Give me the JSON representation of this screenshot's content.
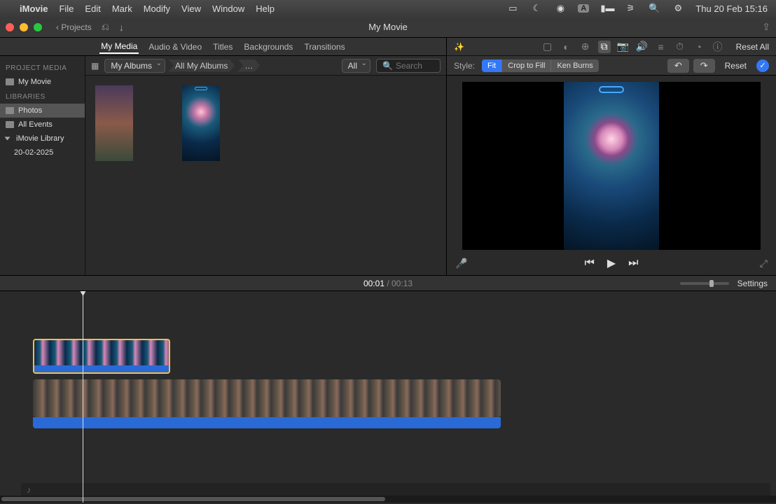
{
  "menubar": {
    "app": "iMovie",
    "items": [
      "File",
      "Edit",
      "Mark",
      "Modify",
      "View",
      "Window",
      "Help"
    ],
    "datetime": "Thu 20 Feb  15:16",
    "a_badge": "A"
  },
  "titlebar": {
    "back_label": "Projects",
    "title": "My Movie"
  },
  "tabs": {
    "my_media": "My Media",
    "audio_video": "Audio & Video",
    "titles": "Titles",
    "backgrounds": "Backgrounds",
    "transitions": "Transitions"
  },
  "sidebar": {
    "project_media_h": "PROJECT MEDIA",
    "project_item": "My Movie",
    "libraries_h": "LIBRARIES",
    "photos": "Photos",
    "all_events": "All Events",
    "imovie_library": "iMovie Library",
    "date_item": "20-02-2025"
  },
  "browser": {
    "dropdown": "My Albums",
    "crumb1": "All My Albums",
    "crumb2": "…",
    "filter": "All",
    "search_placeholder": "Search"
  },
  "adjust": {
    "reset_all": "Reset All"
  },
  "crop": {
    "style_label": "Style:",
    "fit": "Fit",
    "crop_to_fill": "Crop to Fill",
    "ken_burns": "Ken Burns",
    "reset": "Reset"
  },
  "playback": {
    "current": "00:01",
    "separator": " / ",
    "duration": "00:13"
  },
  "timeline": {
    "settings": "Settings"
  }
}
